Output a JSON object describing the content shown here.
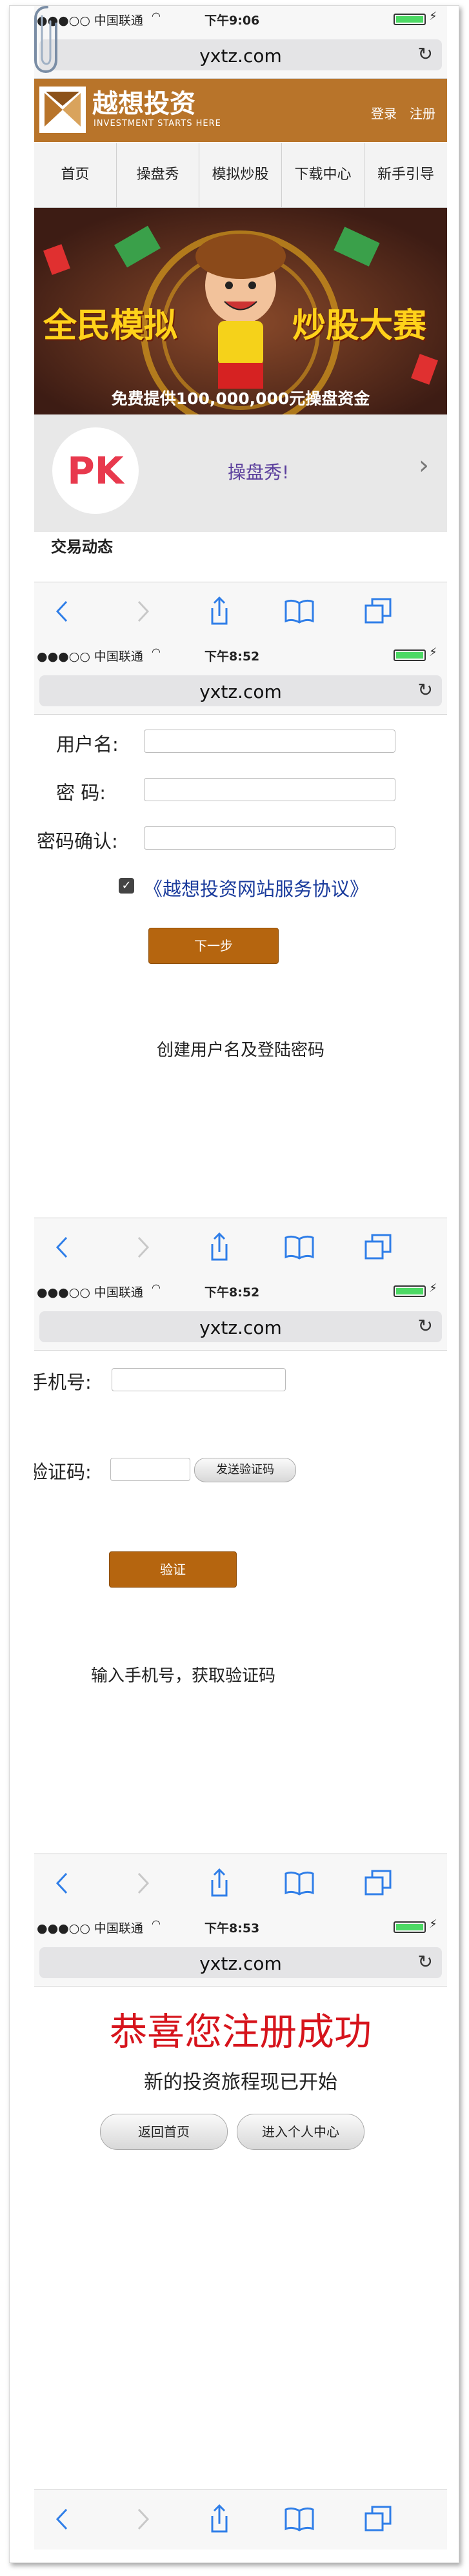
{
  "status": {
    "carrier": "●●●○○ 中国联通",
    "time_1": "下午9:06",
    "time_2": "下午8:52",
    "time_3": "下午8:52",
    "time_4": "下午8:53"
  },
  "browser": {
    "url": "yxtz.com"
  },
  "screen1": {
    "logo_title": "越想投资",
    "logo_subtitle": "INVESTMENT STARTS HERE",
    "login": "登录",
    "register": "注册",
    "nav": [
      "首页",
      "操盘秀",
      "模拟炒股",
      "下载中心",
      "新手引导"
    ],
    "banner_headline_left": "全民模拟",
    "banner_headline_right": "炒股大赛",
    "banner_subline": "免费提供100,000,000元操盘资金",
    "pk_badge": "PK",
    "pk_label": "操盘秀!",
    "section_partial": "交易动态"
  },
  "screen2": {
    "username_label": "用户名:",
    "password_label": "密 码:",
    "confirm_label": "密码确认:",
    "agreement": "《越想投资网站服务协议》",
    "next_button": "下一步",
    "caption": "创建用户名及登陆密码"
  },
  "screen3": {
    "phone_label": "手机号:",
    "code_label": "验证码:",
    "send_code_button": "发送验证码",
    "verify_button": "验证",
    "caption": "输入手机号，获取验证码"
  },
  "screen4": {
    "title": "恭喜您注册成功",
    "subtitle": "新的投资旅程现已开始",
    "home_button": "返回首页",
    "center_button": "进入个人中心"
  },
  "colors": {
    "brand_brown": "#b8742a",
    "button_brown": "#b5650f",
    "success_red": "#d6141c",
    "link_blue": "#1a3b9c",
    "ios_blue": "#2f7ee8"
  }
}
